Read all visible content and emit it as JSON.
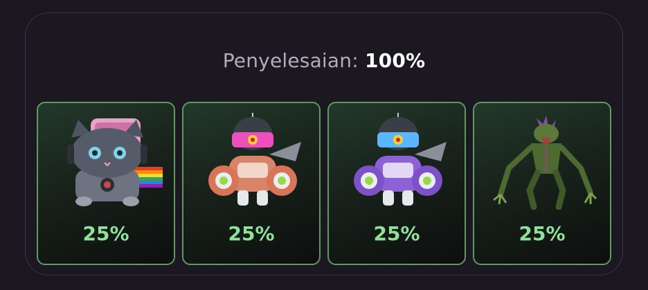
{
  "completion": {
    "label": "Penyelesaian:",
    "value": "100%"
  },
  "cards": [
    {
      "icon": "rainbow-cat-robot-icon",
      "percent": "25%"
    },
    {
      "icon": "orange-mech-robot-icon",
      "percent": "25%"
    },
    {
      "icon": "purple-mech-robot-icon",
      "percent": "25%"
    },
    {
      "icon": "green-alien-creature-icon",
      "percent": "25%"
    }
  ],
  "colors": {
    "accent_green": "#8fe19a",
    "card_border": "#5e9b62",
    "background": "#1b1720"
  }
}
